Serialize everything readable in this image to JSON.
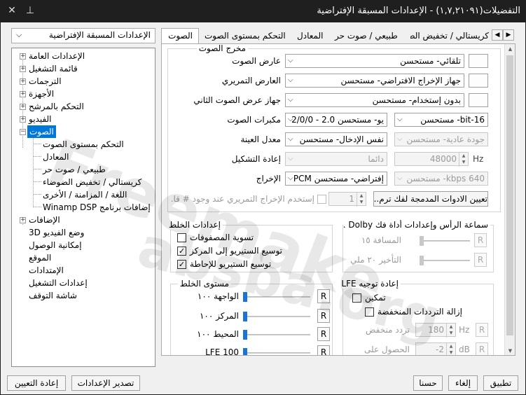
{
  "window": {
    "title": "التفضيلات(١,٧,٢١٠٩١) - الإعدادات المسبقة الإفتراضية",
    "pin_icon": "pin-icon",
    "close_icon": "close-icon"
  },
  "preset": {
    "value": "الإعدادات المسبقة الإفتراضية"
  },
  "tree": {
    "items": [
      "الإعدادات العامة",
      "قائمة التشغيل",
      "الترجمات",
      "الأجهزة",
      "التحكم بالمرشح",
      "الفيديو",
      "الصوت",
      "التحكم بمستوى الصوت",
      "المعادل",
      "طبيعي / صوت حر",
      "كريستالي / تخفيض الضوضاء",
      "اللغة / المزامنة / الأخرى",
      "إضافات برنامج Winamp DSP",
      "الإضافات",
      "وضع الفيديو 3D",
      "إمكانية الوصول",
      "الموقع",
      "الإمتدادات",
      "إعدادات التشغيل",
      "شاشة التوقف"
    ],
    "expand_symbol": "+",
    "collapse_symbol": "−"
  },
  "tabs": [
    "الصوت",
    "التحكم بمستوى الصوت",
    "المعادل",
    "طبيعي / صوت حر",
    "كريستالي / تخفيض الضوضاء"
  ],
  "audio_output": {
    "title": "مخرج الصوت",
    "renderer_label": "عارض الصوت",
    "renderer_value": "تلقائي- مستحسن",
    "pass_label": "العارض التمريري",
    "pass_value": "جهاز الإخراج الافتراضي- مستحسن",
    "second_label": "جهاز عرض الصوت الثاني",
    "second_value": "بدون إستخدام- مستحسن",
    "speakers_label": "مكبرات الصوت",
    "speakers_value": "يو- مستحسن 2.0 - 2/0/0",
    "bits_value": "16-bit- مستحسن",
    "sample_label": "معدل العينة",
    "sample_value": "نفس الإدخال- مستحسن",
    "quality_value": "جودة عادية- مستحسن",
    "resample_label": "إعادة التشكيل",
    "resample_value": "دائما",
    "hz_value": "48000",
    "hz_unit": "Hz",
    "output_label": "الإخراج",
    "output_value": "إفتراضي- مستحسن PCM",
    "bitrate_value": "640 kbps- مستحسن",
    "use_pass_text": "إستخدم الإخراج التمريري عند وجود # قا...",
    "use_pass_count": "1",
    "builtin_button": "تعيين الادوات المدمجة لفك ترم..."
  },
  "mix_settings": {
    "title": "إعدادات الخلط",
    "matrix": "تسوية المصفوفات",
    "stereo_center": "توسيع الستيريو إلى المركز",
    "stereo_surround": "توسيع الستيريو للإحاطة",
    "matrix_checked": "",
    "center_checked": "✓",
    "surround_checked": "✓"
  },
  "dolby": {
    "title": "سماعة الرأس وإعدادات أداة فك Dolby ...",
    "distance": "المسافة ١٥",
    "delay": "التأخير ٢٠ ملي",
    "reset": "R"
  },
  "mix_level": {
    "title": "مستوى الخلط",
    "front": "الواجهة ١٠٠",
    "center": "المركز ١٠٠",
    "surround": "المحيط ١٠٠",
    "lfe": "LFE 100",
    "front_level": 1.0,
    "center_level": 1.0,
    "surround_level": 1.0,
    "lfe_level": 1.0,
    "reset": "R"
  },
  "lfe_route": {
    "title": "إعادة توجيه LFE",
    "enable": "تمكين",
    "lowpass": "إزالة الترددات المنخفضة",
    "lowfreq_label": "تردد منخفض",
    "lowfreq_value": "180",
    "lowfreq_unit": "Hz",
    "gain_label": "الحصول على",
    "gain_value": "-2",
    "gain_unit": "dB",
    "reset": "R"
  },
  "footer": {
    "reset": "إعادة التعيين",
    "export": "تصدير الإعدادات",
    "ok": "حسنا",
    "cancel": "إلغاء",
    "apply": "تطبيق"
  },
  "watermark": {
    "line1": "Freemake",
    "line2": "absba.org"
  }
}
